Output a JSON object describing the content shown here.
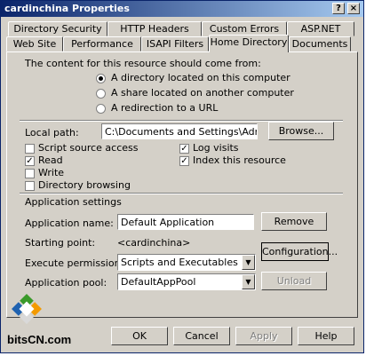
{
  "window": {
    "title": "cardinchina Properties",
    "help_glyph": "?",
    "close_glyph": "×"
  },
  "tabs_row1": [
    {
      "label": "Directory Security"
    },
    {
      "label": "HTTP Headers"
    },
    {
      "label": "Custom Errors"
    },
    {
      "label": "ASP.NET"
    }
  ],
  "tabs_row2": [
    {
      "label": "Web Site"
    },
    {
      "label": "Performance"
    },
    {
      "label": "ISAPI Filters"
    },
    {
      "label": "Home Directory",
      "active": true
    },
    {
      "label": "Documents"
    }
  ],
  "content_source": {
    "heading": "The content for this resource should come from:",
    "options": [
      {
        "label": "A directory located on this computer",
        "selected": true
      },
      {
        "label": "A share located on another computer",
        "selected": false
      },
      {
        "label": "A redirection to a URL",
        "selected": false
      }
    ]
  },
  "local_path": {
    "label": "Local path:",
    "value": "C:\\Documents and Settings\\Administrato",
    "browse_label": "Browse..."
  },
  "permissions": {
    "left": [
      {
        "label": "Script source access",
        "checked": false
      },
      {
        "label": "Read",
        "checked": true
      },
      {
        "label": "Write",
        "checked": false
      },
      {
        "label": "Directory browsing",
        "checked": false
      }
    ],
    "right": [
      {
        "label": "Log visits",
        "checked": true
      },
      {
        "label": "Index this resource",
        "checked": true
      }
    ]
  },
  "app_settings": {
    "heading": "Application settings",
    "app_name_label": "Application name:",
    "app_name_value": "Default Application",
    "remove_label": "Remove",
    "starting_point_label": "Starting point:",
    "starting_point_value": "<cardinchina>",
    "configuration_label": "Configuration...",
    "exec_perm_label": "Execute permissions:",
    "exec_perm_value": "Scripts and Executables",
    "app_pool_label": "Application pool:",
    "app_pool_value": "DefaultAppPool",
    "unload_label": "Unload"
  },
  "footer": {
    "ok_label": "OK",
    "cancel_label": "Cancel",
    "apply_label": "Apply",
    "help_label": "Help"
  },
  "watermark": {
    "text": "bitsCN.com"
  },
  "colors": {
    "titlebar_start": "#0a246a",
    "titlebar_end": "#a6caf0",
    "face": "#d4d0c8"
  }
}
